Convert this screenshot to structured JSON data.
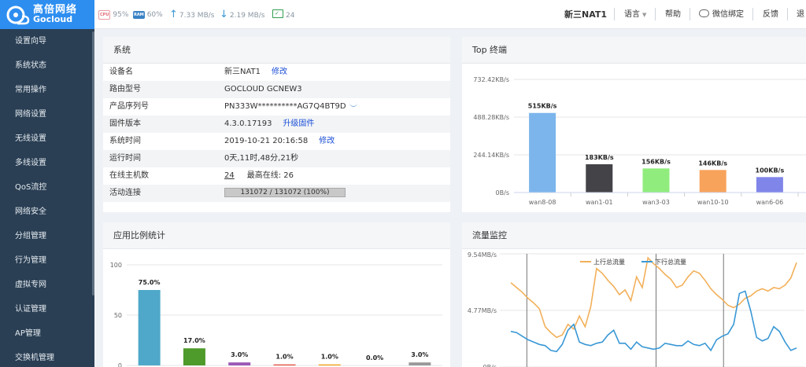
{
  "logo": {
    "cn": "高倍网络",
    "en": "Gocloud"
  },
  "sidebar": {
    "items": [
      {
        "label": "设置向导"
      },
      {
        "label": "系统状态"
      },
      {
        "label": "常用操作"
      },
      {
        "label": "网络设置"
      },
      {
        "label": "无线设置"
      },
      {
        "label": "多线设置"
      },
      {
        "label": "QoS流控"
      },
      {
        "label": "网络安全"
      },
      {
        "label": "分组管理"
      },
      {
        "label": "行为管理"
      },
      {
        "label": "虚拟专网"
      },
      {
        "label": "认证管理"
      },
      {
        "label": "AP管理"
      },
      {
        "label": "交换机管理"
      }
    ]
  },
  "topbar": {
    "cpu_tag": "CPU",
    "cpu": "95%",
    "ram_tag": "RAM",
    "ram": "60%",
    "upload": "7.33 MB/s",
    "download": "2.19 MB/s",
    "clients": "24",
    "device": "新三NAT1",
    "language": "语言",
    "help": "帮助",
    "wechat": "微信绑定",
    "feedback": "反馈",
    "logout": "退"
  },
  "system": {
    "title": "系统",
    "edit_label": "修改",
    "upgrade_label": "升级固件",
    "rows": {
      "device_name": {
        "label": "设备名",
        "value": "新三NAT1"
      },
      "model": {
        "label": "路由型号",
        "value": "GOCLOUD GCNEW3"
      },
      "serial": {
        "label": "产品序列号",
        "value": "PN333W**********AG7Q4BT9D"
      },
      "firmware": {
        "label": "固件版本",
        "value": "4.3.0.17193"
      },
      "time": {
        "label": "系统时间",
        "value": "2019-10-21 20:16:58"
      },
      "uptime": {
        "label": "运行时间",
        "value": "0天,11时,48分,21秒"
      },
      "hosts": {
        "label": "在线主机数",
        "value": "24",
        "max_label": "最高在线:",
        "max_value": "26"
      },
      "conn": {
        "label": "活动连接",
        "value": "131072 / 131072 (100%)",
        "fill": 1.0
      }
    }
  },
  "top_terminals": {
    "title": "Top 终端"
  },
  "app_ratio": {
    "title": "应用比例统计"
  },
  "traffic": {
    "title": "流量监控"
  },
  "colors": {
    "sidebar": "#2a3f54",
    "logo_bg": "#2d8ef0",
    "link": "#1c4fd6",
    "upload_line": "#f2b05a",
    "download_line": "#3a98d6"
  },
  "chart_data": [
    {
      "type": "bar",
      "title": "Top 终端",
      "categories": [
        "wan8-08",
        "wan1-01",
        "wan3-03",
        "wan10-10",
        "wan6-06"
      ],
      "values": [
        515,
        183,
        156,
        146,
        100
      ],
      "value_labels": [
        "515KB/s",
        "183KB/s",
        "156KB/s",
        "146KB/s",
        "100KB/s"
      ],
      "colors": [
        "#7cb5ec",
        "#434348",
        "#90ed7d",
        "#f7a35c",
        "#8085e9"
      ],
      "ylim": [
        0,
        732.42
      ],
      "yticks": [
        0,
        244.14,
        488.28,
        732.42
      ],
      "ytick_labels": [
        "0B/s",
        "244.14KB/s",
        "488.28KB/s",
        "732.42KB/s"
      ],
      "grid": true
    },
    {
      "type": "bar",
      "title": "应用比例统计",
      "values": [
        75.0,
        17.0,
        3.0,
        1.0,
        1.0,
        0.0,
        3.0
      ],
      "value_labels": [
        "75.0%",
        "17.0%",
        "3.0%",
        "1.0%",
        "1.0%",
        "0.0%",
        "3.0%"
      ],
      "colors": [
        "#4fa8c9",
        "#4e9a2a",
        "#9b59b6",
        "#e74c3c",
        "#f39c12",
        "#2ecc71",
        "#999999"
      ],
      "ylim": [
        0,
        100
      ],
      "yticks": [
        0,
        50,
        100
      ],
      "ytick_labels": [
        "0",
        "50",
        "100"
      ],
      "grid": true
    },
    {
      "type": "line",
      "title": "流量监控",
      "series": [
        {
          "name": "上行总流量",
          "color": "#f2b05a",
          "values": [
            7.1,
            6.7,
            6.3,
            5.8,
            5.4,
            4.9,
            3.4,
            2.9,
            2.5,
            2.7,
            3.6,
            3.2,
            4.3,
            3.4,
            5.1,
            8.3,
            7.9,
            7.3,
            6.8,
            6.1,
            6.5,
            5.6,
            7.6,
            6.7,
            9.2,
            8.7,
            8.3,
            7.8,
            7.4,
            6.7,
            6.9,
            7.6,
            8.1,
            7.9,
            7.3,
            6.6,
            6.1,
            5.7,
            5.2,
            5.0,
            5.3,
            5.8,
            6.0,
            6.4,
            6.6,
            6.4,
            6.7,
            6.6,
            6.9,
            7.5,
            8.8
          ]
        },
        {
          "name": "下行总流量",
          "color": "#3a98d6",
          "values": [
            3.0,
            2.9,
            2.6,
            2.3,
            2.1,
            1.9,
            1.8,
            1.4,
            1.3,
            1.9,
            3.1,
            3.6,
            2.1,
            1.9,
            1.8,
            2.0,
            2.1,
            2.7,
            3.1,
            2.0,
            2.0,
            1.5,
            2.1,
            1.7,
            1.6,
            1.5,
            1.6,
            2.0,
            1.9,
            1.8,
            1.8,
            2.2,
            1.9,
            1.8,
            2.0,
            1.4,
            2.3,
            2.6,
            2.8,
            3.6,
            6.2,
            6.4,
            4.7,
            2.5,
            2.2,
            2.4,
            3.4,
            3.0,
            2.1,
            1.4,
            1.6
          ]
        }
      ],
      "ylim": [
        0,
        9.54
      ],
      "yticks": [
        0,
        4.77,
        9.54
      ],
      "ytick_labels": [
        "0B/s",
        "4.77MB/s",
        "9.54MB/s"
      ],
      "legend": "top-center",
      "grid": true
    }
  ]
}
